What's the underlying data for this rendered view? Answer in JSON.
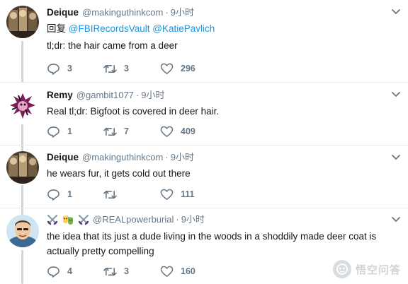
{
  "tweets": [
    {
      "name": "Deique",
      "handle": "@makinguthinkcom",
      "separator": "·",
      "time": "9小时",
      "reply_prefix": "回复",
      "reply_mentions": [
        "@FBIRecordsVault",
        "@KatiePavlich"
      ],
      "text": "tl;dr: the hair came from a deer",
      "replies": "3",
      "retweets": "3",
      "likes": "296"
    },
    {
      "name": "Remy",
      "handle": "@gambit1077",
      "separator": "·",
      "time": "9小时",
      "text": "Real tl;dr: Bigfoot is covered in deer hair.",
      "replies": "1",
      "retweets": "7",
      "likes": "409"
    },
    {
      "name": "Deique",
      "handle": "@makinguthinkcom",
      "separator": "·",
      "time": "9小时",
      "text": "he wears fur, it gets cold out there",
      "replies": "1",
      "retweets": "",
      "likes": "111"
    },
    {
      "name": "",
      "handle": "@REALpowerburial",
      "separator": "·",
      "time": "9小时",
      "name_emojis": [
        "crossed-swords-icon",
        "performing-arts-icon",
        "crossed-swords-icon"
      ],
      "text_line1": "the idea that its just a dude living in the woods in a shoddily made deer coat is",
      "text_line2": "actually pretty compelling",
      "replies": "4",
      "retweets": "3",
      "likes": "160"
    }
  ],
  "watermark": {
    "text": "悟空问答"
  },
  "colors": {
    "link": "#1b95e0",
    "muted": "#657786",
    "divider": "#e6ecf0",
    "thread_line": "#ccd6dd"
  }
}
